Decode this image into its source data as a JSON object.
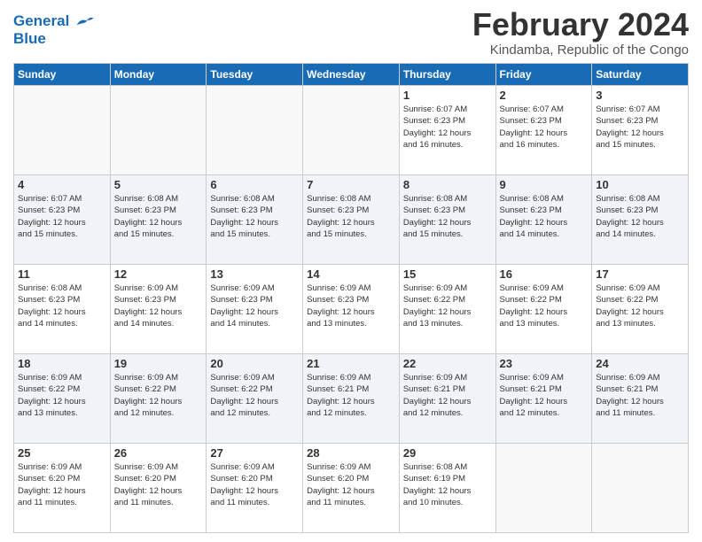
{
  "header": {
    "logo_line1": "General",
    "logo_line2": "Blue",
    "month_year": "February 2024",
    "location": "Kindamba, Republic of the Congo"
  },
  "days_of_week": [
    "Sunday",
    "Monday",
    "Tuesday",
    "Wednesday",
    "Thursday",
    "Friday",
    "Saturday"
  ],
  "weeks": [
    {
      "alt": false,
      "days": [
        {
          "num": "",
          "info": ""
        },
        {
          "num": "",
          "info": ""
        },
        {
          "num": "",
          "info": ""
        },
        {
          "num": "",
          "info": ""
        },
        {
          "num": "1",
          "info": "Sunrise: 6:07 AM\nSunset: 6:23 PM\nDaylight: 12 hours\nand 16 minutes."
        },
        {
          "num": "2",
          "info": "Sunrise: 6:07 AM\nSunset: 6:23 PM\nDaylight: 12 hours\nand 16 minutes."
        },
        {
          "num": "3",
          "info": "Sunrise: 6:07 AM\nSunset: 6:23 PM\nDaylight: 12 hours\nand 15 minutes."
        }
      ]
    },
    {
      "alt": true,
      "days": [
        {
          "num": "4",
          "info": "Sunrise: 6:07 AM\nSunset: 6:23 PM\nDaylight: 12 hours\nand 15 minutes."
        },
        {
          "num": "5",
          "info": "Sunrise: 6:08 AM\nSunset: 6:23 PM\nDaylight: 12 hours\nand 15 minutes."
        },
        {
          "num": "6",
          "info": "Sunrise: 6:08 AM\nSunset: 6:23 PM\nDaylight: 12 hours\nand 15 minutes."
        },
        {
          "num": "7",
          "info": "Sunrise: 6:08 AM\nSunset: 6:23 PM\nDaylight: 12 hours\nand 15 minutes."
        },
        {
          "num": "8",
          "info": "Sunrise: 6:08 AM\nSunset: 6:23 PM\nDaylight: 12 hours\nand 15 minutes."
        },
        {
          "num": "9",
          "info": "Sunrise: 6:08 AM\nSunset: 6:23 PM\nDaylight: 12 hours\nand 14 minutes."
        },
        {
          "num": "10",
          "info": "Sunrise: 6:08 AM\nSunset: 6:23 PM\nDaylight: 12 hours\nand 14 minutes."
        }
      ]
    },
    {
      "alt": false,
      "days": [
        {
          "num": "11",
          "info": "Sunrise: 6:08 AM\nSunset: 6:23 PM\nDaylight: 12 hours\nand 14 minutes."
        },
        {
          "num": "12",
          "info": "Sunrise: 6:09 AM\nSunset: 6:23 PM\nDaylight: 12 hours\nand 14 minutes."
        },
        {
          "num": "13",
          "info": "Sunrise: 6:09 AM\nSunset: 6:23 PM\nDaylight: 12 hours\nand 14 minutes."
        },
        {
          "num": "14",
          "info": "Sunrise: 6:09 AM\nSunset: 6:23 PM\nDaylight: 12 hours\nand 13 minutes."
        },
        {
          "num": "15",
          "info": "Sunrise: 6:09 AM\nSunset: 6:22 PM\nDaylight: 12 hours\nand 13 minutes."
        },
        {
          "num": "16",
          "info": "Sunrise: 6:09 AM\nSunset: 6:22 PM\nDaylight: 12 hours\nand 13 minutes."
        },
        {
          "num": "17",
          "info": "Sunrise: 6:09 AM\nSunset: 6:22 PM\nDaylight: 12 hours\nand 13 minutes."
        }
      ]
    },
    {
      "alt": true,
      "days": [
        {
          "num": "18",
          "info": "Sunrise: 6:09 AM\nSunset: 6:22 PM\nDaylight: 12 hours\nand 13 minutes."
        },
        {
          "num": "19",
          "info": "Sunrise: 6:09 AM\nSunset: 6:22 PM\nDaylight: 12 hours\nand 12 minutes."
        },
        {
          "num": "20",
          "info": "Sunrise: 6:09 AM\nSunset: 6:22 PM\nDaylight: 12 hours\nand 12 minutes."
        },
        {
          "num": "21",
          "info": "Sunrise: 6:09 AM\nSunset: 6:21 PM\nDaylight: 12 hours\nand 12 minutes."
        },
        {
          "num": "22",
          "info": "Sunrise: 6:09 AM\nSunset: 6:21 PM\nDaylight: 12 hours\nand 12 minutes."
        },
        {
          "num": "23",
          "info": "Sunrise: 6:09 AM\nSunset: 6:21 PM\nDaylight: 12 hours\nand 12 minutes."
        },
        {
          "num": "24",
          "info": "Sunrise: 6:09 AM\nSunset: 6:21 PM\nDaylight: 12 hours\nand 11 minutes."
        }
      ]
    },
    {
      "alt": false,
      "days": [
        {
          "num": "25",
          "info": "Sunrise: 6:09 AM\nSunset: 6:20 PM\nDaylight: 12 hours\nand 11 minutes."
        },
        {
          "num": "26",
          "info": "Sunrise: 6:09 AM\nSunset: 6:20 PM\nDaylight: 12 hours\nand 11 minutes."
        },
        {
          "num": "27",
          "info": "Sunrise: 6:09 AM\nSunset: 6:20 PM\nDaylight: 12 hours\nand 11 minutes."
        },
        {
          "num": "28",
          "info": "Sunrise: 6:09 AM\nSunset: 6:20 PM\nDaylight: 12 hours\nand 11 minutes."
        },
        {
          "num": "29",
          "info": "Sunrise: 6:08 AM\nSunset: 6:19 PM\nDaylight: 12 hours\nand 10 minutes."
        },
        {
          "num": "",
          "info": ""
        },
        {
          "num": "",
          "info": ""
        }
      ]
    }
  ]
}
